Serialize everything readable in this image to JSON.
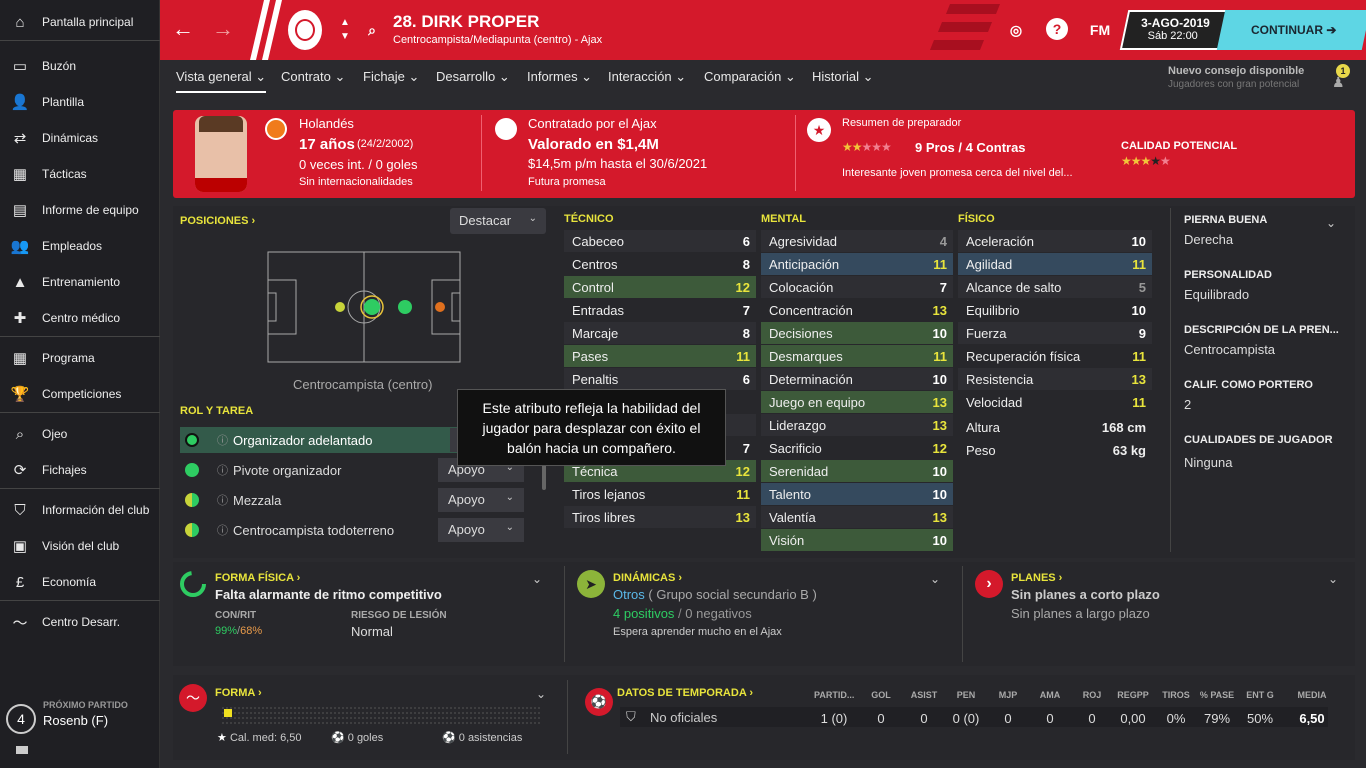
{
  "sidebar": {
    "items": [
      {
        "label": "Pantalla principal",
        "icon": "home-icon"
      },
      {
        "label": "Buzón",
        "icon": "inbox-icon"
      },
      {
        "label": "Plantilla",
        "icon": "squad-icon"
      },
      {
        "label": "Dinámicas",
        "icon": "dynamics-icon"
      },
      {
        "label": "Tácticas",
        "icon": "tactics-icon"
      },
      {
        "label": "Informe de equipo",
        "icon": "report-icon"
      },
      {
        "label": "Empleados",
        "icon": "staff-icon"
      },
      {
        "label": "Entrenamiento",
        "icon": "training-icon"
      },
      {
        "label": "Centro médico",
        "icon": "medical-icon"
      },
      {
        "label": "Programa",
        "icon": "calendar-icon"
      },
      {
        "label": "Competiciones",
        "icon": "trophy-icon"
      },
      {
        "label": "Ojeo",
        "icon": "scouting-icon"
      },
      {
        "label": "Fichajes",
        "icon": "transfers-icon"
      },
      {
        "label": "Información del club",
        "icon": "club-info-icon"
      },
      {
        "label": "Visión del club",
        "icon": "club-vision-icon"
      },
      {
        "label": "Economía",
        "icon": "finances-icon"
      },
      {
        "label": "Centro Desarr.",
        "icon": "development-icon"
      }
    ],
    "next_match": {
      "label": "PRÓXIMO PARTIDO",
      "opponent": "Rosenb (F)",
      "days": "4"
    }
  },
  "header": {
    "player_name": "28. DIRK PROPER",
    "subtitle": "Centrocampista/Mediapunta (centro) - Ajax",
    "fm_label": "FM",
    "date": "3-AGO-2019",
    "time": "Sáb 22:00",
    "continue_label": "CONTINUAR",
    "accent": "#d4192b",
    "continue_color": "#5ed6e4"
  },
  "tabs": [
    {
      "label": "Vista general ⌄"
    },
    {
      "label": "Contrato ⌄"
    },
    {
      "label": "Fichaje ⌄"
    },
    {
      "label": "Desarrollo ⌄"
    },
    {
      "label": "Informes ⌄"
    },
    {
      "label": "Interacción ⌄"
    },
    {
      "label": "Comparación ⌄"
    },
    {
      "label": "Historial ⌄"
    }
  ],
  "tip": {
    "title": "Nuevo consejo disponible",
    "subtitle": "Jugadores con gran potencial",
    "count": "1"
  },
  "banner": {
    "nationality": "Holandés",
    "age": "17 años",
    "dob": "(24/2/2002)",
    "caps": "0 veces int. / 0 goles",
    "caps_note": "Sin internacionalidades",
    "signed": "Contratado por el Ajax",
    "value": "Valorado en $1,4M",
    "wage": "$14,5m p/m hasta el 30/6/2021",
    "status": "Futura promesa",
    "coach_summary": "Resumen de preparador",
    "pros_cons": "9 Pros / 4 Contras",
    "coach_note": "Interesante joven promesa cerca del nivel del...",
    "potential_label": "CALIDAD POTENCIAL",
    "current_stars": 2.5,
    "potential_stars": 3.5
  },
  "positions": {
    "title": "POSICIONES",
    "highlight_label": "Destacar",
    "position_name": "Centrocampista (centro)"
  },
  "roles": {
    "title": "ROL Y TAREA",
    "items": [
      {
        "name": "Organizador adelantado",
        "duty": "A"
      },
      {
        "name": "Pivote organizador",
        "duty": "Apoyo"
      },
      {
        "name": "Mezzala",
        "duty": "Apoyo"
      },
      {
        "name": "Centrocampista todoterreno",
        "duty": "Apoyo"
      }
    ]
  },
  "attributes": {
    "technical_title": "TÉCNICO",
    "mental_title": "MENTAL",
    "physical_title": "FÍSICO",
    "technical": [
      {
        "name": "Cabeceo",
        "value": "6"
      },
      {
        "name": "Centros",
        "value": "8"
      },
      {
        "name": "Control",
        "value": "12",
        "hl": "green"
      },
      {
        "name": "Entradas",
        "value": "7"
      },
      {
        "name": "Marcaje",
        "value": "8"
      },
      {
        "name": "Pases",
        "value": "11",
        "hl": "green"
      },
      {
        "name": "Penaltis",
        "value": "6"
      },
      {
        "name": "",
        "value": ""
      },
      {
        "name": "",
        "value": ""
      },
      {
        "name": "Saques largos",
        "value": "7"
      },
      {
        "name": "Técnica",
        "value": "12",
        "hl": "green"
      },
      {
        "name": "Tiros lejanos",
        "value": "11"
      },
      {
        "name": "Tiros libres",
        "value": "13"
      }
    ],
    "mental": [
      {
        "name": "Agresividad",
        "value": "4"
      },
      {
        "name": "Anticipación",
        "value": "11",
        "hl": "blue"
      },
      {
        "name": "Colocación",
        "value": "7"
      },
      {
        "name": "Concentración",
        "value": "13"
      },
      {
        "name": "Decisiones",
        "value": "10",
        "hl": "green"
      },
      {
        "name": "Desmarques",
        "value": "11",
        "hl": "green"
      },
      {
        "name": "Determinación",
        "value": "10"
      },
      {
        "name": "Juego en equipo",
        "value": "13",
        "hl": "green"
      },
      {
        "name": "Liderazgo",
        "value": "13"
      },
      {
        "name": "Sacrificio",
        "value": "12"
      },
      {
        "name": "Serenidad",
        "value": "10",
        "hl": "green"
      },
      {
        "name": "Talento",
        "value": "10",
        "hl": "blue"
      },
      {
        "name": "Valentía",
        "value": "13"
      },
      {
        "name": "Visión",
        "value": "10",
        "hl": "green"
      }
    ],
    "physical": [
      {
        "name": "Aceleración",
        "value": "10"
      },
      {
        "name": "Agilidad",
        "value": "11",
        "hl": "blue"
      },
      {
        "name": "Alcance de salto",
        "value": "5"
      },
      {
        "name": "Equilibrio",
        "value": "10"
      },
      {
        "name": "Fuerza",
        "value": "9"
      },
      {
        "name": "Recuperación física",
        "value": "11"
      },
      {
        "name": "Resistencia",
        "value": "13"
      },
      {
        "name": "Velocidad",
        "value": "11"
      }
    ],
    "height_label": "Altura",
    "height": "168 cm",
    "weight_label": "Peso",
    "weight": "63 kg"
  },
  "tooltip": "Este atributo refleja la habilidad del jugador para desplazar con éxito el balón hacia un compañero.",
  "info": {
    "foot_label": "PIERNA BUENA",
    "foot": "Derecha",
    "personality_label": "PERSONALIDAD",
    "personality": "Equilibrado",
    "desc_label": "DESCRIPCIÓN DE LA PREN...",
    "desc": "Centrocampista",
    "gk_label": "CALIF. COMO PORTERO",
    "gk": "2",
    "qualities_label": "CUALIDADES DE JUGADOR",
    "qualities": "Ninguna"
  },
  "fitness": {
    "title": "FORMA FÍSICA",
    "status": "Falta alarmante de ritmo competitivo",
    "conrit_label": "CON/RIT",
    "con": "99%",
    "rit": "68%",
    "injury_label": "RIESGO DE LESIÓN",
    "injury": "Normal"
  },
  "dynamics": {
    "title": "DINÁMICAS",
    "group": "Otros",
    "group_detail": "( Grupo social secundario B )",
    "positives": "4 positivos",
    "negatives": "0 negativos",
    "note": "Espera aprender mucho en el Ajax"
  },
  "plans": {
    "title": "PLANES",
    "short": "Sin planes a corto plazo",
    "long": "Sin planes a largo plazo"
  },
  "form": {
    "title": "FORMA",
    "avg": "Cal. med: 6,50",
    "goals": "0 goles",
    "assists": "0 asistencias"
  },
  "season": {
    "title": "DATOS DE TEMPORADA",
    "headers": [
      "PARTID...",
      "GOL",
      "ASIST",
      "PEN",
      "MJP",
      "AMA",
      "ROJ",
      "REGPP",
      "TIROS",
      "% PASE",
      "ENT G",
      "MEDIA"
    ],
    "row_label": "No oficiales",
    "values": [
      "1 (0)",
      "0",
      "0",
      "0 (0)",
      "0",
      "0",
      "0",
      "0,00",
      "0%",
      "79%",
      "50%",
      "6,50"
    ]
  }
}
